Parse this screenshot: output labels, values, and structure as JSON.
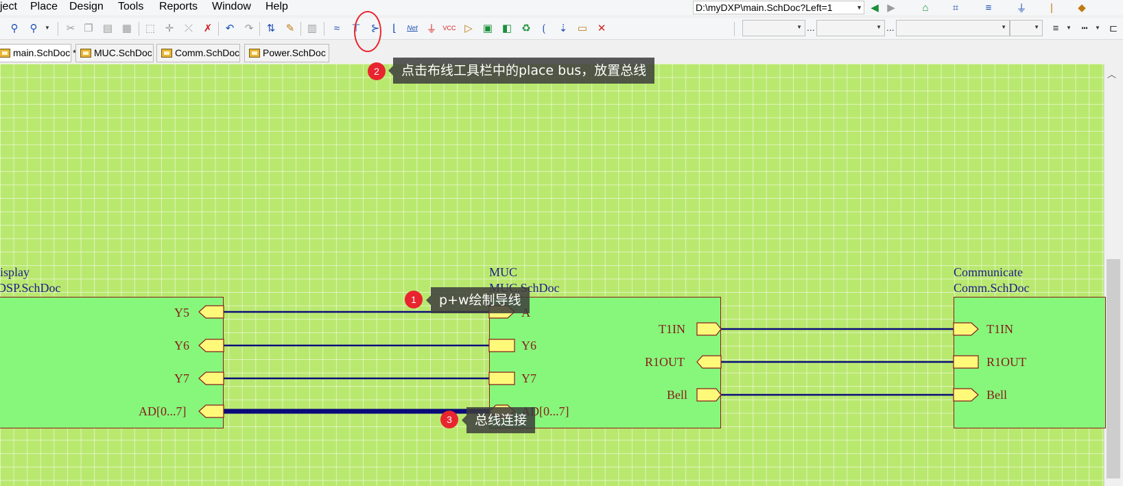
{
  "menu": [
    "ject",
    "Place",
    "Design",
    "Tools",
    "Reports",
    "Window",
    "Help"
  ],
  "path_value": "D:\\myDXP\\main.SchDoc?Left=1",
  "tabs": [
    {
      "label": "main.SchDoc *",
      "active": true
    },
    {
      "label": "MUC.SchDoc",
      "active": false
    },
    {
      "label": "Comm.SchDoc",
      "active": false
    },
    {
      "label": "Power.SchDoc",
      "active": false
    }
  ],
  "toolbar": {
    "net_label": "Net",
    "vcc_label": "VCC",
    "combo_ellipsis": "..."
  },
  "sheets": {
    "display": {
      "name": "isplay",
      "file": "DSP.SchDoc"
    },
    "muc": {
      "name": "MUC",
      "file": "MUC.SchDoc"
    },
    "comm": {
      "name": "Communicate",
      "file": "Comm.SchDoc"
    }
  },
  "ports": {
    "display": [
      "Y5",
      "Y6",
      "Y7",
      "AD[0...7]"
    ],
    "muc_left": [
      "A",
      "Y6",
      "Y7",
      "AD[0...7]"
    ],
    "muc_right": [
      "T1IN",
      "R1OUT",
      "Bell"
    ],
    "comm": [
      "T1IN",
      "R1OUT",
      "Bell"
    ]
  },
  "callouts": {
    "step1": {
      "num": "1",
      "text": "p+w绘制导线"
    },
    "step2": {
      "num": "2",
      "text": "点击布线工具栏中的place  bus，放置总线"
    },
    "step3": {
      "num": "3",
      "text": "总线连接"
    }
  },
  "colors": {
    "canvas": "#b9e86f",
    "sheet_fill": "#86f77b",
    "sheet_border": "#8b1b1b",
    "wire": "#0a0a7a",
    "port_fill": "#fff97a",
    "callout_badge": "#e8252f"
  }
}
